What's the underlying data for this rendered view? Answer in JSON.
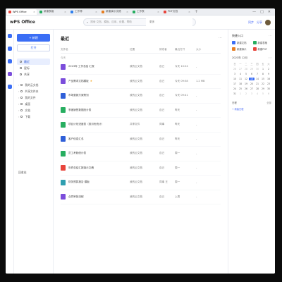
{
  "tabs": [
    {
      "label": "WPS Office",
      "color": "#e8453c",
      "active": true
    },
    {
      "label": "新建表格",
      "color": "#27ae60"
    },
    {
      "label": "工作簿",
      "color": "#2f80ed"
    },
    {
      "label": "新建演示文稿",
      "color": "#e67e22"
    },
    {
      "label": "工作表",
      "color": "#27ae60"
    },
    {
      "label": "PDF文档",
      "color": "#e8453c"
    }
  ],
  "window_controls": [
    "—",
    "□",
    "✕"
  ],
  "brand": "wPS Office",
  "search": {
    "placeholder": "搜索 文档、模板、应用、设置、帮助",
    "right_label": "更多"
  },
  "topbar_right": {
    "sync": "同步",
    "share": "分享"
  },
  "rail_colors": [
    "#3b6ef5",
    "#3b6ef5",
    "#3b6ef5",
    "#7b4ddb",
    "#3b6ef5"
  ],
  "nav": {
    "new_label": "+ 新建",
    "open_label": "打开",
    "items": [
      {
        "label": "最近",
        "active": true
      },
      {
        "label": "星标"
      },
      {
        "label": "共享"
      }
    ],
    "tree": [
      "我的云文档",
      "共享文件夹",
      "我的文件",
      "桌面",
      "文档",
      "下载"
    ],
    "footer": "回收站"
  },
  "main": {
    "title": "最近",
    "more": "⋯",
    "columns": [
      "文件名",
      "位置",
      "修改者",
      "最近打开",
      "大小"
    ],
    "group_label": "今天",
    "rows": [
      {
        "name": "2023年 工作总结 汇报 ",
        "icon": "#7b4ddb",
        "loc": "我的云文档",
        "by": "自己",
        "time": "今天 10:24",
        "size": "-",
        "star": false
      },
      {
        "name": "产品需求文档模板",
        "icon": "#7b4ddb",
        "loc": "我的云文档",
        "by": "自己",
        "time": "今天 09:58",
        "size": "1.2 MB",
        "star": true
      },
      {
        "name": "市场营销方案策划 ",
        "icon": "#2f5fd8",
        "loc": "我的云文档",
        "by": "自己",
        "time": "今天 09:41",
        "size": "-",
        "star": false
      },
      {
        "name": "季度销售数据统计表",
        "icon": "#27ae60",
        "loc": "我的云文档",
        "by": "自己",
        "time": "昨天",
        "size": "-",
        "star": false
      },
      {
        "name": "项目计划进度表（按月份统计）",
        "icon": "#27ae60",
        "loc": "共享文件",
        "by": "同事",
        "time": "昨天",
        "size": "-",
        "star": false
      },
      {
        "name": "客户信息汇总 ",
        "icon": "#2f5fd8",
        "loc": "我的云文档",
        "by": "自己",
        "time": "昨天",
        "size": "-",
        "star": false
      },
      {
        "name": "员工考勤统计表",
        "icon": "#27ae60",
        "loc": "我的云文档",
        "by": "自己",
        "time": "周一",
        "size": "-",
        "star": false
      },
      {
        "name": "年终总结汇报演示文稿 ",
        "icon": "#e8453c",
        "loc": "我的云文档",
        "by": "自己",
        "time": "周一",
        "size": "-",
        "star": false
      },
      {
        "name": "财务预算报告 模板 ",
        "icon": "#2f9fb0",
        "loc": "我的云文档",
        "by": "同事 王",
        "time": "周一",
        "size": "-",
        "star": false
      },
      {
        "name": "合同审批流程 ",
        "icon": "#7b4ddb",
        "loc": "我的云文档",
        "by": "自己",
        "time": "上周",
        "size": "-",
        "star": false
      }
    ]
  },
  "right_panel": {
    "title": "快捷入口",
    "more": "⋯",
    "quick": [
      {
        "label": "新建文档",
        "color": "#3b6ef5"
      },
      {
        "label": "新建表格",
        "color": "#27ae60"
      },
      {
        "label": "新建演示",
        "color": "#e67e22"
      },
      {
        "label": "新建PDF",
        "color": "#e8453c"
      }
    ],
    "calendar_title": "2023年 12月",
    "calendar_nav": "‹ ›",
    "weekdays": [
      "日",
      "一",
      "二",
      "三",
      "四",
      "五",
      "六"
    ],
    "days": [
      "26",
      "27",
      "28",
      "29",
      "30",
      "1",
      "2",
      "3",
      "4",
      "5",
      "6",
      "7",
      "8",
      "9",
      "10",
      "11",
      "12",
      "13",
      "14",
      "15",
      "16",
      "17",
      "18",
      "19",
      "20",
      "21",
      "22",
      "23",
      "24",
      "25",
      "26",
      "27",
      "28",
      "29",
      "30",
      "31",
      "1",
      "2",
      "3",
      "4",
      "5",
      "6"
    ],
    "today_index": 17,
    "schedule_title": "日程",
    "schedule_more": "全部",
    "schedule_add": "+ 新建日程"
  }
}
